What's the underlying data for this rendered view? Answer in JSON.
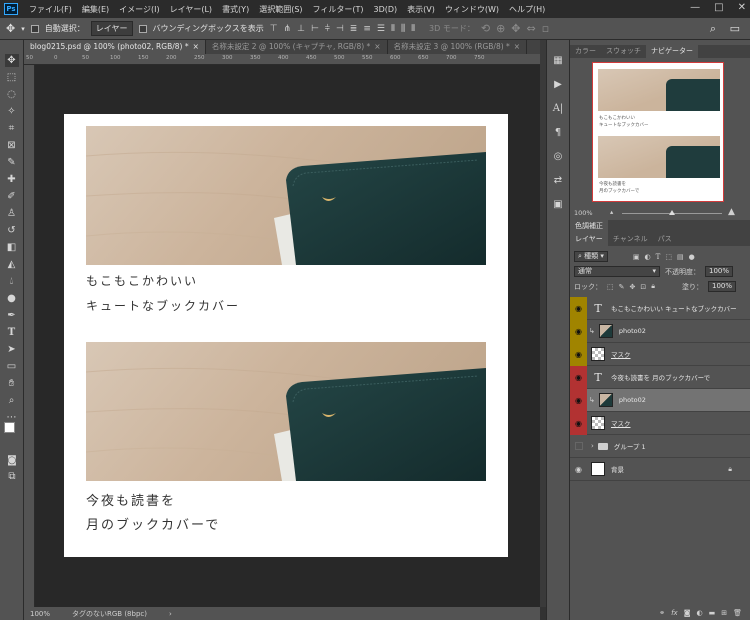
{
  "app": {
    "logo": "Ps",
    "menu": [
      "ファイル(F)",
      "編集(E)",
      "イメージ(I)",
      "レイヤー(L)",
      "書式(Y)",
      "選択範囲(S)",
      "フィルター(T)",
      "3D(D)",
      "表示(V)",
      "ウィンドウ(W)",
      "ヘルプ(H)"
    ],
    "window_controls": [
      "—",
      "□",
      "✕"
    ]
  },
  "options_bar": {
    "move_icon": "move-tool-icon",
    "auto_select_label": "自動選択：",
    "auto_select_value": "レイヤー",
    "transform_label": "バウンディングボックスを表示",
    "mode_3d_label": "3D モード："
  },
  "tabs": [
    {
      "title": "blog0215.psd @ 100% (photo02, RGB/8) *",
      "active": true
    },
    {
      "title": "名称未設定 2 @ 100% (キャプチャ, RGB/8) *",
      "active": false
    },
    {
      "title": "名称未設定 3 @ 100% (RGB/8) *",
      "active": false
    }
  ],
  "ruler_ticks": [
    "50",
    "0",
    "50",
    "100",
    "150",
    "200",
    "250",
    "300",
    "350",
    "400",
    "450",
    "500",
    "550",
    "600",
    "650",
    "700",
    "750"
  ],
  "document": {
    "section1_line1": "もこもこかわいい",
    "section1_line2": "キュートなブックカバー",
    "section2_line1": "今夜も読書を",
    "section2_line2": "月のブックカバーで"
  },
  "status": {
    "zoom": "100%",
    "profile": "タグのないRGB (8bpc)"
  },
  "navigator": {
    "tabs": [
      "カラー",
      "スウォッチ",
      "ナビゲーター"
    ],
    "zoom": "100%",
    "zoom_level": 0.5,
    "preview_line1": "もこもこかわいい",
    "preview_line2": "キュートなブックカバー",
    "preview_line3": "今夜も読書を",
    "preview_line4": "月のブックカバーで"
  },
  "adjust_tab": "色調補正",
  "layers_panel": {
    "tabs": [
      "レイヤー",
      "チャンネル",
      "パス"
    ],
    "filter_kind": "種類",
    "blend_mode": "通常",
    "opacity_label": "不透明度：",
    "opacity": "100%",
    "lock_label": "ロック：",
    "fill_label": "塗り：",
    "fill": "100%",
    "layers": [
      {
        "name": "もこもこかわいい キュートなブックカバー",
        "kind": "type",
        "color": "yellow",
        "visible": true,
        "selected": false
      },
      {
        "name": "photo02",
        "kind": "photo",
        "color": "yellow",
        "visible": true,
        "selected": false,
        "clipped": true
      },
      {
        "name": "マスク",
        "kind": "mask",
        "color": "yellow",
        "visible": true,
        "selected": false
      },
      {
        "name": "今夜も読書を 月のブックカバーで",
        "kind": "type",
        "color": "red",
        "visible": true,
        "selected": false
      },
      {
        "name": "photo02",
        "kind": "photo",
        "color": "red",
        "visible": true,
        "selected": true,
        "clipped": true
      },
      {
        "name": "マスク",
        "kind": "mask",
        "color": "red",
        "visible": true,
        "selected": false
      },
      {
        "name": "グループ 1",
        "kind": "group",
        "color": "none",
        "visible": false,
        "selected": false
      },
      {
        "name": "背景",
        "kind": "background",
        "color": "none",
        "visible": true,
        "selected": false,
        "locked": true
      }
    ],
    "footer_icons": [
      "link-icon",
      "fx-icon",
      "mask-icon",
      "adjustment-icon",
      "folder-icon",
      "new-layer-icon",
      "trash-icon"
    ]
  },
  "colors": {
    "ui_bg": "#535353",
    "canvas_bg": "#282828",
    "label_yellow": "#a08400",
    "label_red": "#b23232",
    "nav_frame": "#d23b3b"
  }
}
